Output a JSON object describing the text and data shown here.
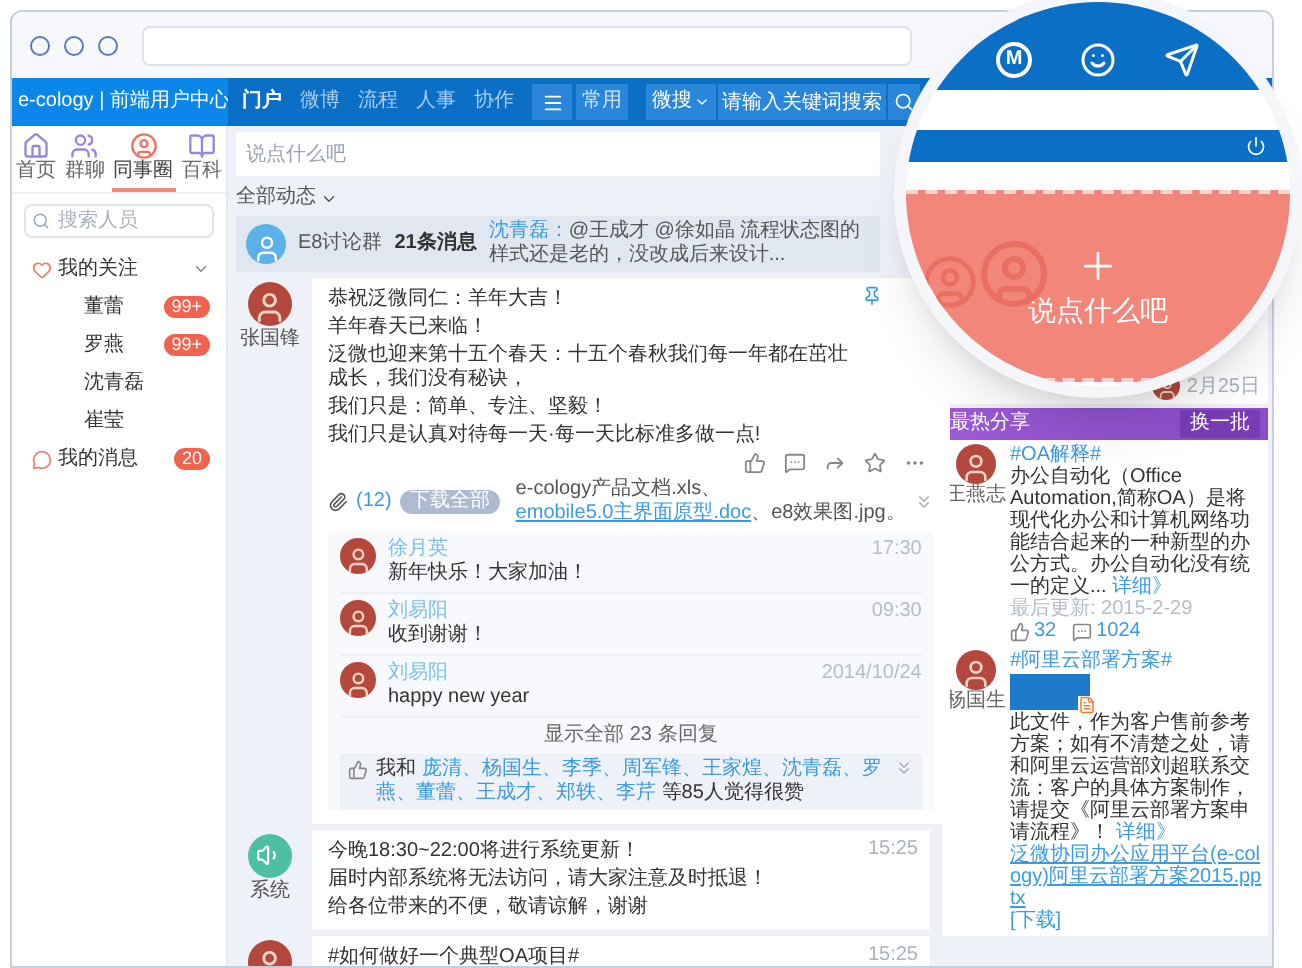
{
  "header": {
    "brand": "e-cology | 前端用户中心",
    "nav": [
      {
        "label": "门户",
        "selected": true
      },
      {
        "label": "微博",
        "selected": false
      },
      {
        "label": "流程",
        "selected": false
      },
      {
        "label": "人事",
        "selected": false
      },
      {
        "label": "协作",
        "selected": false
      }
    ],
    "shortcut": "常用",
    "search_scope": "微搜",
    "search": {
      "placeholder": "请输入关键词搜索"
    }
  },
  "sidebar": {
    "tabs": [
      {
        "label": "首页",
        "selected": false
      },
      {
        "label": "群聊",
        "selected": false
      },
      {
        "label": "同事圈",
        "selected": true
      },
      {
        "label": "百科",
        "selected": false
      }
    ],
    "search": {
      "placeholder": "搜索人员"
    },
    "tree": [
      {
        "label": "我的关注",
        "expanded": true,
        "children": [
          {
            "label": "董蕾",
            "badge": "99+"
          },
          {
            "label": "罗燕",
            "badge": "99+"
          },
          {
            "label": "沈青磊"
          },
          {
            "label": "崔莹"
          }
        ]
      },
      {
        "label": "我的消息",
        "badge": "20"
      }
    ]
  },
  "compose": {
    "placeholder": "说点什么吧"
  },
  "filter": {
    "label": "全部动态"
  },
  "group_bar": {
    "name": "E8讨论群",
    "count": "21条消息",
    "sender": "沈青磊：",
    "preview": "@王成才 @徐如晶 流程状态图的样式还是老的，没改成后来设计..."
  },
  "posts": [
    {
      "kind": "user",
      "author": "张国锋",
      "pinned": true,
      "lines": [
        "恭祝泛微同仁：羊年大吉！",
        "羊年春天已来临！",
        "泛微也迎来第十五个春天：十五个春秋我们每一年都在茁壮成长，我们没有秘诀，",
        "我们只是：简单、专注、坚毅！",
        "我们只是认真对待每一天·每一天比标准多做一点!"
      ],
      "attachments": {
        "count": "(12)",
        "download_all": "下载全部",
        "files": [
          {
            "name": "e-cology产品文档.xls、",
            "link": false
          },
          {
            "name": "emobile5.0主界面原型.doc",
            "link": true
          },
          {
            "name": "、e8效果图.jpg。",
            "link": false
          }
        ]
      },
      "replies": [
        {
          "author": "徐月英",
          "text": "新年快乐！大家加油！",
          "time": "17:30"
        },
        {
          "author": "刘易阳",
          "text": "收到谢谢！",
          "time": "09:30"
        },
        {
          "author": "刘易阳",
          "text": "happy new year",
          "time": "2014/10/24"
        }
      ],
      "show_all": "显示全部 23 条回复",
      "likes": {
        "prefix": "我和",
        "names": "庞清、杨国生、李季、周军锋、王家煌、沈青磊、罗燕、董蕾、王成才、郑轶、李芹",
        "suffix": "等85人觉得很赞"
      }
    },
    {
      "kind": "system",
      "author": "系统",
      "pinned": false,
      "time": "15:25",
      "lines": [
        "今晚18:30~22:00将进行系统更新！",
        "届时内部系统将无法访问，请大家注意及时抵退！",
        "给各位带来的不便，敬请谅解，谢谢"
      ]
    },
    {
      "kind": "user",
      "pinned": false,
      "time": "15:25",
      "lines": [
        "#如何做好一个典型OA项目#"
      ]
    }
  ],
  "right_panel": {
    "top_card": {
      "date": "2月25日"
    },
    "hot": {
      "title": "最热分享",
      "refresh": "换一批",
      "items": [
        {
          "kind": "text",
          "author": "王燕志",
          "tag": "#OA解释#",
          "text": "办公自动化（Office Automation,简称OA）是将现代化办公和计算机网络功能结合起来的一种新型的办公方式。办公自动化没有统一的定义...",
          "more": "详细》",
          "updated": "最后更新: 2015-2-29",
          "likes": "32",
          "comments": "1024"
        },
        {
          "kind": "file",
          "author": "杨国生",
          "tag": "#阿里云部署方案#",
          "text": "此文件，作为客户售前参考方案；如有不清楚之处，请和阿里云运营部刘超联系交流：客户的具体方案制作，请提交《阿里云部署方案申请流程》！",
          "more": "详细》",
          "file": "泛微协同办公应用平台(e-cology)阿里云部署方案2015.pptx",
          "download": "[下载]"
        }
      ]
    }
  },
  "magnifier": {
    "letter": "M",
    "prompt": "说点什么吧"
  }
}
